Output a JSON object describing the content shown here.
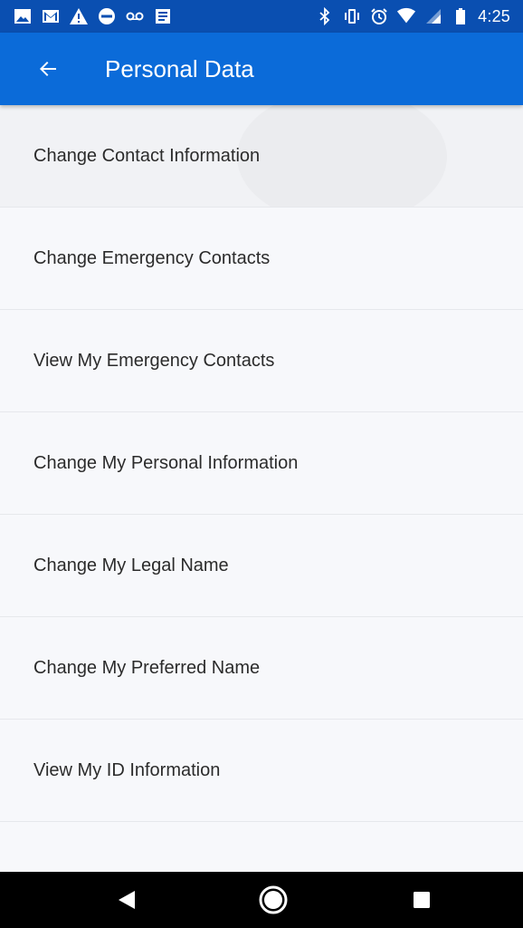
{
  "status_bar": {
    "time": "4:25",
    "colors": {
      "background": "#0a4fb1"
    },
    "left_icons": [
      "image-icon",
      "gmail-icon",
      "warning-icon",
      "do-not-disturb-icon",
      "voicemail-icon",
      "news-icon"
    ],
    "right_icons": [
      "bluetooth-icon",
      "vibrate-icon",
      "alarm-icon",
      "wifi-icon",
      "signal-icon",
      "battery-icon"
    ]
  },
  "app_bar": {
    "title": "Personal Data",
    "back_icon": "arrow-back-icon",
    "colors": {
      "background": "#0b6bd9"
    }
  },
  "menu": {
    "items": [
      {
        "label": "Change Contact Information"
      },
      {
        "label": "Change Emergency Contacts"
      },
      {
        "label": "View My Emergency Contacts"
      },
      {
        "label": "Change My Personal Information"
      },
      {
        "label": "Change My Legal Name"
      },
      {
        "label": "Change My Preferred Name"
      },
      {
        "label": "View My ID Information"
      },
      {
        "label": ""
      }
    ]
  },
  "nav_bar": {
    "buttons": [
      "back-triangle-icon",
      "home-circle-icon",
      "recents-square-icon"
    ]
  }
}
